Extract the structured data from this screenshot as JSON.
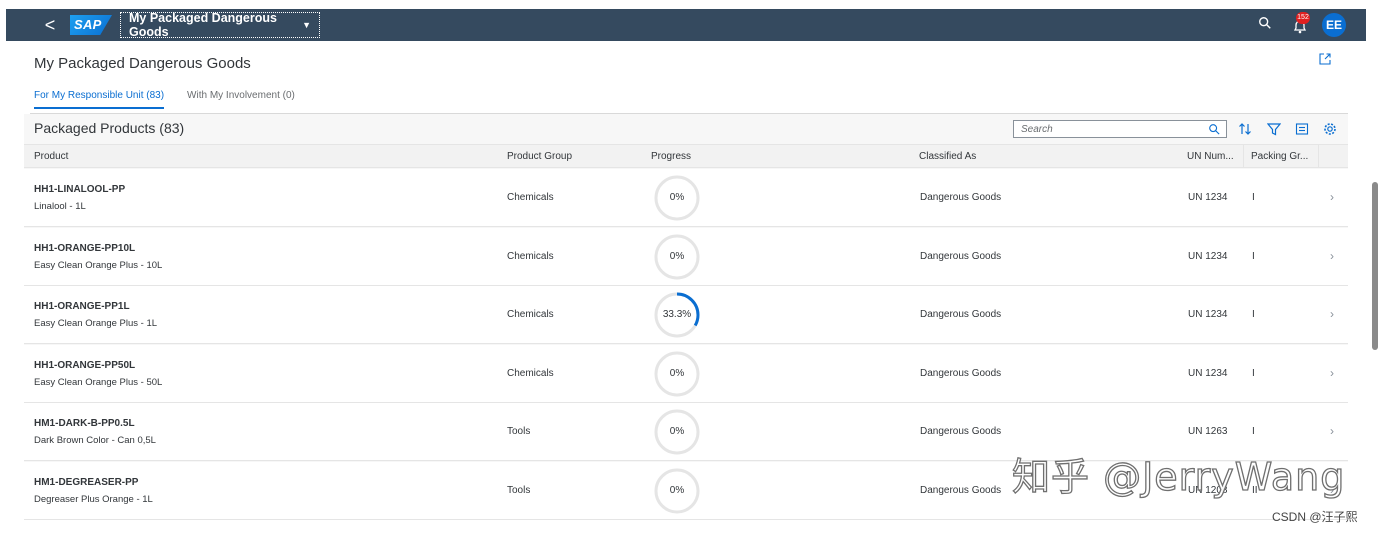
{
  "shell": {
    "back_symbol": "<",
    "logo_text": "SAP",
    "app_title": "My Packaged Dangerous Goods",
    "notification_count": "152",
    "avatar_initials": "EE"
  },
  "page": {
    "title": "My Packaged Dangerous Goods"
  },
  "tabs": [
    {
      "label": "For My Responsible Unit (83)",
      "active": true
    },
    {
      "label": "With My Involvement (0)",
      "active": false
    }
  ],
  "table": {
    "title": "Packaged Products (83)",
    "search_placeholder": "Search",
    "columns": [
      "Product",
      "Product Group",
      "Progress",
      "Classified As",
      "UN Num...",
      "Packing Gr..."
    ],
    "rows": [
      {
        "id": "HH1-LINALOOL-PP",
        "name": "Linalool - 1L",
        "group": "Chemicals",
        "progress": 0,
        "progress_label": "0%",
        "classified": "Dangerous Goods",
        "un": "UN 1234",
        "packing": "I"
      },
      {
        "id": "HH1-ORANGE-PP10L",
        "name": "Easy Clean Orange Plus - 10L",
        "group": "Chemicals",
        "progress": 0,
        "progress_label": "0%",
        "classified": "Dangerous Goods",
        "un": "UN 1234",
        "packing": "I"
      },
      {
        "id": "HH1-ORANGE-PP1L",
        "name": "Easy Clean Orange Plus - 1L",
        "group": "Chemicals",
        "progress": 33.3,
        "progress_label": "33.3%",
        "classified": "Dangerous Goods",
        "un": "UN 1234",
        "packing": "I"
      },
      {
        "id": "HH1-ORANGE-PP50L",
        "name": "Easy Clean Orange Plus - 50L",
        "group": "Chemicals",
        "progress": 0,
        "progress_label": "0%",
        "classified": "Dangerous Goods",
        "un": "UN 1234",
        "packing": "I"
      },
      {
        "id": "HM1-DARK-B-PP0.5L",
        "name": "Dark Brown Color - Can 0,5L",
        "group": "Tools",
        "progress": 0,
        "progress_label": "0%",
        "classified": "Dangerous Goods",
        "un": "UN 1263",
        "packing": "I"
      },
      {
        "id": "HM1-DEGREASER-PP",
        "name": "Degreaser Plus Orange - 1L",
        "group": "Tools",
        "progress": 0,
        "progress_label": "0%",
        "classified": "Dangerous Goods",
        "un": "UN 1208",
        "packing": "II"
      }
    ]
  },
  "watermark": "知乎 @JerryWang",
  "credit": "CSDN @汪子熙",
  "colors": {
    "shell_bg": "#354a5f",
    "accent": "#0a6ed1",
    "badge": "#e02020",
    "ring_track": "#e5e5e5"
  },
  "icons": {
    "back": "chevron-left-icon",
    "search": "search-icon",
    "notifications": "bell-icon",
    "export": "export-icon",
    "sort": "sort-icon",
    "filter": "filter-icon",
    "group": "group-icon",
    "settings": "gear-icon",
    "row_nav": "chevron-right-icon"
  }
}
